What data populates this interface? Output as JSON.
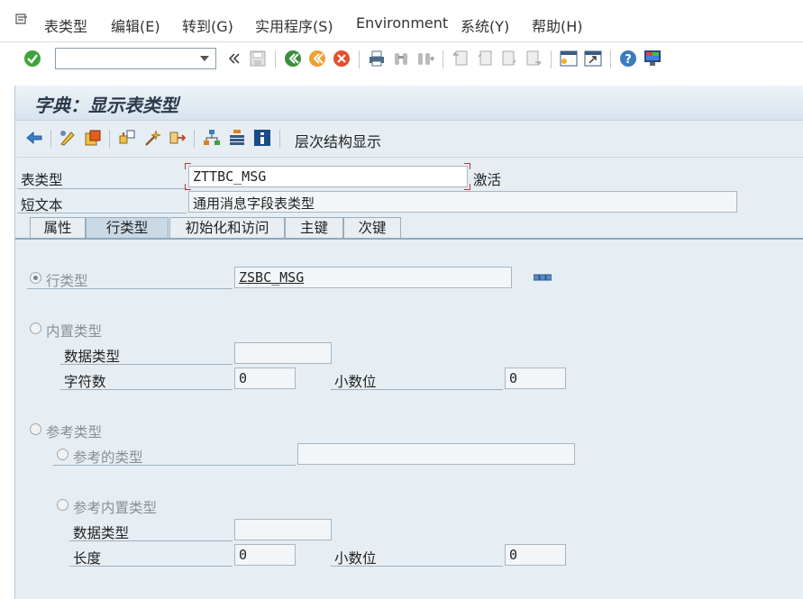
{
  "menubar": {
    "items": [
      {
        "label": "表类型"
      },
      {
        "label": "编辑(E)"
      },
      {
        "label": "转到(G)"
      },
      {
        "label": "实用程序(S)"
      },
      {
        "label": "Environment"
      },
      {
        "label": "系统(Y)"
      },
      {
        "label": "帮助(H)"
      }
    ]
  },
  "toolbar": {
    "command_field": "",
    "icons": [
      "enter-icon",
      "back-double-icon",
      "save-icon",
      "back-icon",
      "exit-icon",
      "cancel-icon",
      "print-icon",
      "find-icon",
      "find-next-icon",
      "first-page-icon",
      "prev-page-icon",
      "next-page-icon",
      "last-page-icon",
      "new-session-icon",
      "shortcut-icon",
      "help-icon",
      "customize-icon"
    ]
  },
  "page": {
    "title": "字典：显示表类型"
  },
  "app_toolbar": {
    "hierarchy_label": "层次结构显示"
  },
  "header": {
    "table_type_label": "表类型",
    "table_type_value": "ZTTBC_MSG",
    "status": "激活",
    "short_text_label": "短文本",
    "short_text_value": "通用消息字段表类型"
  },
  "tabs": [
    {
      "label": "属性",
      "active": false
    },
    {
      "label": "行类型",
      "active": true
    },
    {
      "label": "初始化和访问",
      "active": false
    },
    {
      "label": "主键",
      "active": false
    },
    {
      "label": "次键",
      "active": false
    }
  ],
  "line_type": {
    "row_type_label": "行类型",
    "row_type_value": "ZSBC_MSG",
    "builtin_label": "内置类型",
    "data_type_label": "数据类型",
    "data_type_value": "",
    "chars_label": "字符数",
    "chars_value": "0",
    "decimals_label": "小数位",
    "decimals_value": "0",
    "ref_label": "参考类型",
    "ref_to_type_label": "参考的类型",
    "ref_to_type_value": "",
    "ref_builtin_label": "参考内置类型",
    "ref_data_type_label": "数据类型",
    "ref_data_type_value": "",
    "length_label": "长度",
    "length_value": "0",
    "ref_decimals_label": "小数位",
    "ref_decimals_value": "0"
  }
}
